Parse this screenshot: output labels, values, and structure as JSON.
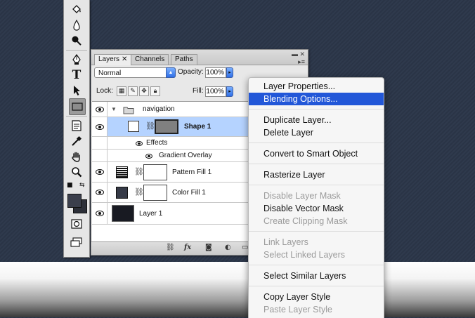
{
  "tools_palette": {
    "tools": [
      "paint-bucket",
      "blur",
      "burn",
      "pen",
      "type",
      "path-selection",
      "rectangle",
      "notes",
      "eyedropper",
      "hand",
      "zoom"
    ],
    "selected_tool": "rectangle",
    "foreground_color": "#3b3f4c",
    "background_color": "#2c2f38"
  },
  "layers_panel": {
    "tabs": [
      {
        "label": "Layers",
        "active": true
      },
      {
        "label": "Channels",
        "active": false
      },
      {
        "label": "Paths",
        "active": false
      }
    ],
    "blend_mode": "Normal",
    "opacity_label": "Opacity:",
    "opacity_value": "100%",
    "lock_label": "Lock:",
    "fill_label": "Fill:",
    "fill_value": "100%",
    "layers": [
      {
        "name": "navigation",
        "kind": "group"
      },
      {
        "name": "Shape 1",
        "kind": "shape",
        "selected": true
      },
      {
        "name": "Effects",
        "kind": "effects"
      },
      {
        "name": "Gradient Overlay",
        "kind": "effect"
      },
      {
        "name": "Pattern Fill 1",
        "kind": "fill"
      },
      {
        "name": "Color Fill 1",
        "kind": "fill"
      },
      {
        "name": "Layer 1",
        "kind": "pixel"
      }
    ],
    "footer_fx": "fx"
  },
  "context_menu": {
    "items": [
      {
        "label": "Layer Properties...",
        "state": "normal"
      },
      {
        "label": "Blending Options...",
        "state": "highlighted"
      },
      {
        "label": "Duplicate Layer...",
        "state": "normal"
      },
      {
        "label": "Delete Layer",
        "state": "normal"
      },
      {
        "label": "Convert to Smart Object",
        "state": "normal"
      },
      {
        "label": "Rasterize Layer",
        "state": "normal"
      },
      {
        "label": "Disable Layer Mask",
        "state": "disabled"
      },
      {
        "label": "Disable Vector Mask",
        "state": "normal"
      },
      {
        "label": "Create Clipping Mask",
        "state": "disabled"
      },
      {
        "label": "Link Layers",
        "state": "disabled"
      },
      {
        "label": "Select Linked Layers",
        "state": "disabled"
      },
      {
        "label": "Select Similar Layers",
        "state": "normal"
      },
      {
        "label": "Copy Layer Style",
        "state": "normal"
      },
      {
        "label": "Paste Layer Style",
        "state": "disabled"
      }
    ],
    "highlight_color": "#2257d8"
  }
}
